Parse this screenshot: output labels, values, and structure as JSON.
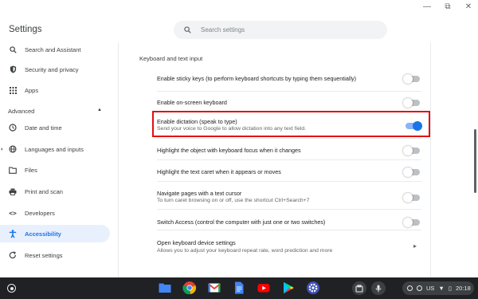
{
  "window": {
    "controls": [
      "minimize",
      "restore",
      "close"
    ]
  },
  "header": {
    "title": "Settings",
    "search_placeholder": "Search settings"
  },
  "sidebar": {
    "items": [
      {
        "label": "Search and Assistant",
        "icon": "search-icon"
      },
      {
        "label": "Security and privacy",
        "icon": "shield-icon"
      },
      {
        "label": "Apps",
        "icon": "apps-grid-icon"
      }
    ],
    "advanced_label": "Advanced",
    "advanced_items": [
      {
        "label": "Date and time",
        "icon": "clock-icon"
      },
      {
        "label": "Languages and inputs",
        "icon": "globe-icon"
      },
      {
        "label": "Files",
        "icon": "folder-icon"
      },
      {
        "label": "Print and scan",
        "icon": "printer-icon"
      },
      {
        "label": "Developers",
        "icon": "code-icon"
      },
      {
        "label": "Accessibility",
        "icon": "accessibility-icon",
        "active": true
      },
      {
        "label": "Reset settings",
        "icon": "reset-icon"
      }
    ]
  },
  "main": {
    "section_title": "Keyboard and text input",
    "rows": [
      {
        "label": "Enable sticky keys (to perform keyboard shortcuts by typing them sequentially)",
        "sub": "",
        "toggle": false
      },
      {
        "label": "Enable on-screen keyboard",
        "sub": "",
        "toggle": false
      },
      {
        "label": "Enable dictation (speak to type)",
        "sub": "Send your voice to Google to allow dictation into any text field.",
        "toggle": true,
        "highlighted": true
      },
      {
        "label": "Highlight the object with keyboard focus when it changes",
        "sub": "",
        "toggle": false
      },
      {
        "label": "Highlight the text caret when it appears or moves",
        "sub": "",
        "toggle": false
      },
      {
        "label": "Navigate pages with a text cursor",
        "sub": "To turn caret browsing on or off, use the shortcut Ctrl+Search+7",
        "toggle": false
      },
      {
        "label": "Switch Access (control the computer with just one or two switches)",
        "sub": "",
        "toggle": false
      },
      {
        "label": "Open keyboard device settings",
        "sub": "Allows you to adjust your keyboard repeat rate, word prediction and more",
        "link": true
      }
    ]
  },
  "shelf": {
    "apps": [
      "files-app-icon",
      "chrome-icon",
      "gmail-icon",
      "docs-icon",
      "youtube-icon",
      "play-store-icon",
      "settings-app-icon"
    ],
    "status": {
      "region": "US",
      "time": "20:18"
    }
  },
  "colors": {
    "accent": "#1a73e8",
    "highlight": "#e01010",
    "shelf": "#202124"
  }
}
